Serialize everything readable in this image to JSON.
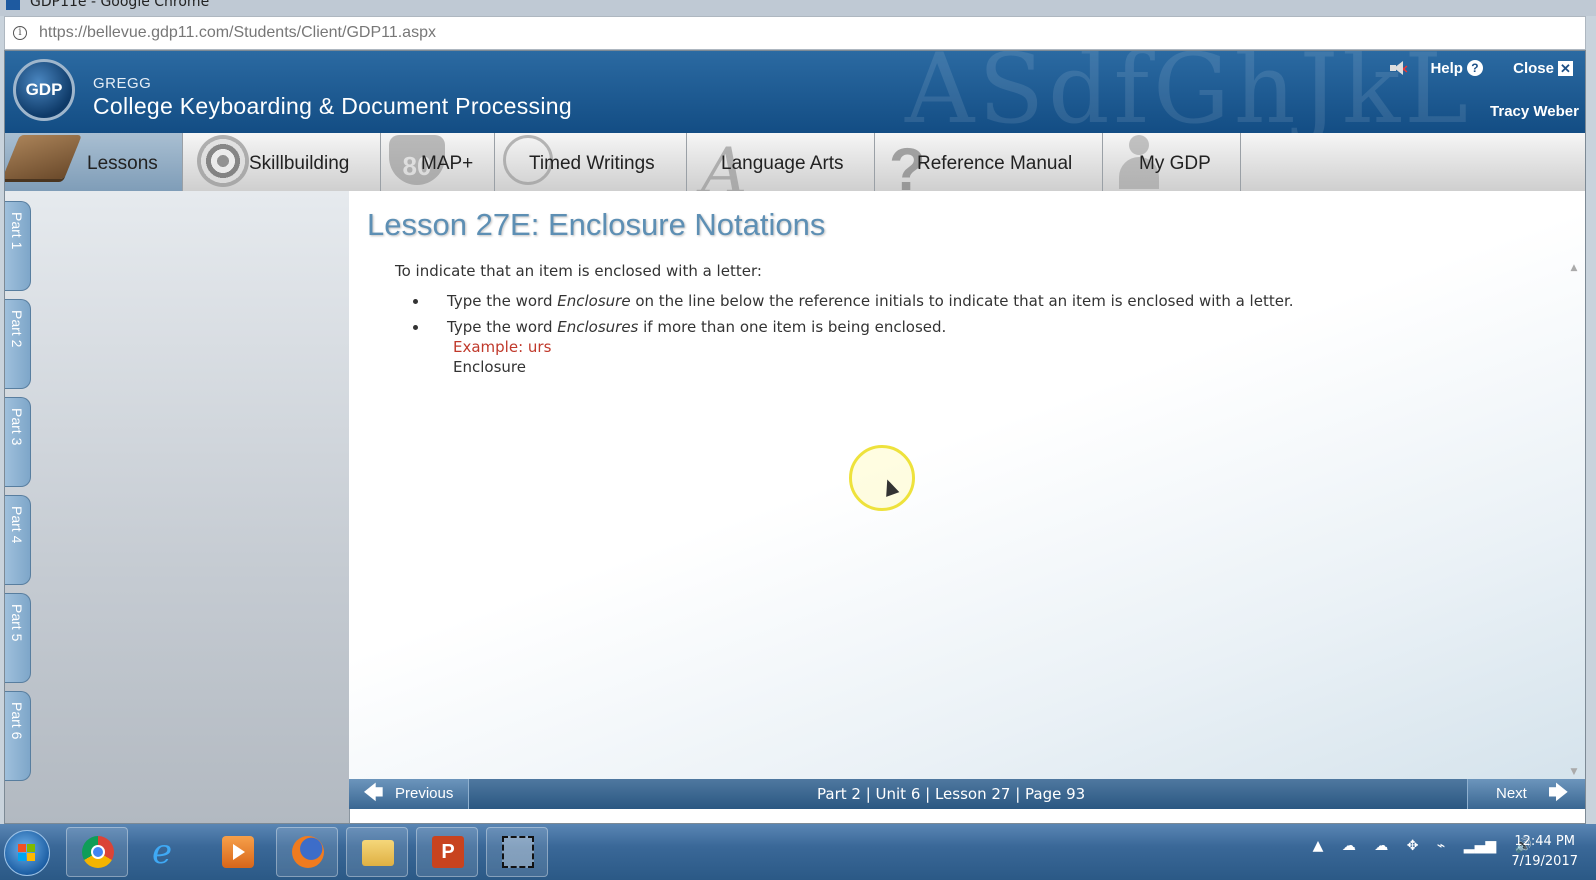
{
  "browser": {
    "window_title": "GDP11e - Google Chrome",
    "url": "https://bellevue.gdp11.com/Students/Client/GDP11.aspx"
  },
  "header": {
    "logo_text": "GDP",
    "brand_small": "GREGG",
    "brand_title": "College Keyboarding & Document Processing",
    "watermark": "ASdfGhJkL",
    "help_label": "Help",
    "close_label": "Close",
    "user_name": "Tracy Weber"
  },
  "nav": {
    "tabs": [
      {
        "label": "Lessons",
        "active": true
      },
      {
        "label": "Skillbuilding",
        "active": false
      },
      {
        "label": "MAP+",
        "active": false
      },
      {
        "label": "Timed Writings",
        "active": false
      },
      {
        "label": "Language Arts",
        "active": false
      },
      {
        "label": "Reference Manual",
        "active": false
      },
      {
        "label": "My GDP",
        "active": false
      }
    ]
  },
  "sidebar": {
    "parts": [
      "Part 1",
      "Part 2",
      "Part 3",
      "Part 4",
      "Part 5",
      "Part 6"
    ]
  },
  "lesson": {
    "title": "Lesson 27E: Enclosure Notations",
    "intro": "To indicate that an item is enclosed with a letter:",
    "bullet1_pre": "Type the word ",
    "bullet1_em": "Enclosure",
    "bullet1_post": " on the line below the reference initials to indicate that an item is enclosed with a letter.",
    "bullet2_pre": "Type the word ",
    "bullet2_em": "Enclosures",
    "bullet2_post": " if more than one item is being enclosed.",
    "example_label": "Example: urs",
    "example_line": "Enclosure"
  },
  "footer": {
    "previous_label": "Previous",
    "next_label": "Next",
    "breadcrumb": "Part 2 | Unit 6 | Lesson 27 | Page 93"
  },
  "taskbar": {
    "time": "12:44 PM",
    "date": "7/19/2017",
    "apps": [
      "chrome-icon",
      "internet-explorer-icon",
      "media-player-icon",
      "firefox-icon",
      "file-explorer-icon",
      "powerpoint-icon",
      "snipping-tool-icon"
    ]
  }
}
